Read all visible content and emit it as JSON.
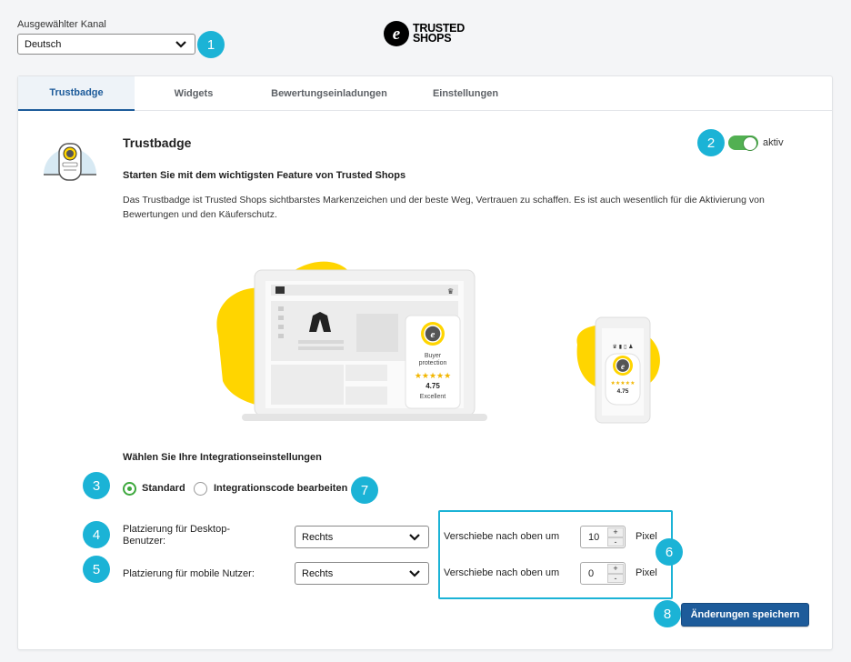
{
  "channel": {
    "label": "Ausgewählter Kanal",
    "value": "Deutsch"
  },
  "logo": {
    "line1": "TRUSTED",
    "line2": "SHOPS"
  },
  "tabs": [
    {
      "label": "Trustbadge",
      "active": true
    },
    {
      "label": "Widgets",
      "active": false
    },
    {
      "label": "Bewertungseinladungen",
      "active": false
    },
    {
      "label": "Einstellungen",
      "active": false
    }
  ],
  "section": {
    "title": "Trustbadge",
    "subtitle": "Starten Sie mit dem wichtigsten Feature von Trusted Shops",
    "description": "Das Trustbadge ist Trusted Shops sichtbarstes Markenzeichen und der beste Weg, Vertrauen zu schaffen. Es ist auch wesentlich für die Aktivierung von Bewertungen und den Käuferschutz.",
    "toggle_label": "aktiv",
    "toggle_on": true
  },
  "illustration": {
    "desktop_badge": {
      "line1": "Buyer",
      "line2": "protection",
      "stars": "★★★★★",
      "score": "4.75",
      "rating": "Excellent"
    },
    "mobile_badge": {
      "stars": "★★★★★",
      "score": "4.75"
    }
  },
  "integration": {
    "title": "Wählen Sie Ihre Integrationseinstellungen",
    "options": [
      {
        "label": "Standard",
        "checked": true
      },
      {
        "label": "Integrationscode bearbeiten",
        "checked": false
      }
    ]
  },
  "placement": {
    "desktop": {
      "label": "Platzierung für Desktop-Benutzer:",
      "value": "Rechts",
      "shift_label": "Verschiebe nach oben um",
      "offset": "10",
      "unit": "Pixel"
    },
    "mobile": {
      "label": "Platzierung für mobile Nutzer:",
      "value": "Rechts",
      "shift_label": "Verschiebe nach oben um",
      "offset": "0",
      "unit": "Pixel"
    }
  },
  "stepper": {
    "plus": "+",
    "minus": "-"
  },
  "save_label": "Änderungen speichern",
  "callouts": [
    "1",
    "2",
    "3",
    "4",
    "5",
    "6",
    "7",
    "8"
  ],
  "colors": {
    "accent": "#1d5b9a",
    "callout": "#1bb3d6",
    "toggle": "#52b052",
    "yellow": "#ffd500"
  }
}
